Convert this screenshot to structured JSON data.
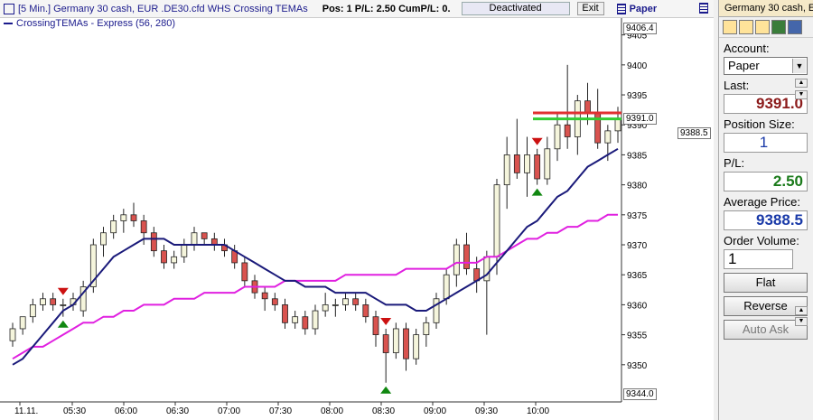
{
  "topbar": {
    "title": "[5 Min.] Germany 30 cash, EUR  .DE30.cfd WHS Crossing TEMAs",
    "stats": "Pos: 1  P/L: 2.50  CumP/L: 0.",
    "status_button": "Deactivated",
    "exit_button": "Exit",
    "account_label": "Paper"
  },
  "legend": {
    "text": "CrossingTEMAs - Express  (56, 280)"
  },
  "price_tags": {
    "top": "9406.4",
    "current": "9391.0",
    "average": "9388.5",
    "bottom": "9344.0"
  },
  "colors": {
    "fast_tema": "#1a1a7a",
    "slow_tema": "#e020e0",
    "candle_up": "#f5f5dc",
    "candle_down": "#d9534f",
    "stop_line": "#e03030",
    "target_line": "#33cc33"
  },
  "chart_data": {
    "type": "candlestick",
    "ylim": [
      9345,
      9406
    ],
    "yticks": [
      9350,
      9355,
      9360,
      9365,
      9370,
      9375,
      9380,
      9385,
      9390,
      9395,
      9400,
      9405
    ],
    "xticks": [
      "11.11.",
      "05:30",
      "06:00",
      "06:30",
      "07:00",
      "07:30",
      "08:00",
      "08:30",
      "09:00",
      "09:30",
      "10:00"
    ],
    "candles": [
      [
        9354,
        9357,
        9353,
        9356
      ],
      [
        9356,
        9358,
        9355,
        9358
      ],
      [
        9358,
        9361,
        9357,
        9360
      ],
      [
        9360,
        9362,
        9359,
        9361
      ],
      [
        9361,
        9362,
        9359,
        9360
      ],
      [
        9360,
        9361,
        9358,
        9360
      ],
      [
        9360,
        9362,
        9359,
        9361
      ],
      [
        9359,
        9364,
        9358,
        9363
      ],
      [
        9363,
        9371,
        9362,
        9370
      ],
      [
        9370,
        9373,
        9368,
        9372
      ],
      [
        9372,
        9375,
        9371,
        9374
      ],
      [
        9374,
        9376,
        9372,
        9375
      ],
      [
        9375,
        9377,
        9373,
        9374
      ],
      [
        9374,
        9375,
        9370,
        9372
      ],
      [
        9372,
        9373,
        9368,
        9369
      ],
      [
        9369,
        9370,
        9366,
        9367
      ],
      [
        9367,
        9369,
        9366,
        9368
      ],
      [
        9368,
        9371,
        9367,
        9370
      ],
      [
        9370,
        9373,
        9369,
        9372
      ],
      [
        9372,
        9372,
        9370,
        9371
      ],
      [
        9371,
        9372,
        9369,
        9370
      ],
      [
        9370,
        9371,
        9368,
        9369
      ],
      [
        9369,
        9370,
        9366,
        9367
      ],
      [
        9367,
        9368,
        9363,
        9364
      ],
      [
        9364,
        9365,
        9361,
        9362
      ],
      [
        9362,
        9363,
        9359,
        9361
      ],
      [
        9361,
        9362,
        9359,
        9360
      ],
      [
        9360,
        9361,
        9356,
        9357
      ],
      [
        9357,
        9359,
        9356,
        9358
      ],
      [
        9358,
        9359,
        9355,
        9356
      ],
      [
        9356,
        9360,
        9355,
        9359
      ],
      [
        9359,
        9362,
        9358,
        9360
      ],
      [
        9360,
        9361,
        9358,
        9360
      ],
      [
        9360,
        9362,
        9359,
        9361
      ],
      [
        9361,
        9362,
        9359,
        9360
      ],
      [
        9360,
        9361,
        9357,
        9358
      ],
      [
        9358,
        9359,
        9353,
        9355
      ],
      [
        9355,
        9356,
        9347,
        9352
      ],
      [
        9352,
        9357,
        9351,
        9356
      ],
      [
        9356,
        9357,
        9349,
        9351
      ],
      [
        9351,
        9356,
        9350,
        9355
      ],
      [
        9355,
        9358,
        9353,
        9357
      ],
      [
        9357,
        9362,
        9356,
        9361
      ],
      [
        9361,
        9366,
        9360,
        9365
      ],
      [
        9365,
        9371,
        9363,
        9370
      ],
      [
        9370,
        9372,
        9365,
        9366
      ],
      [
        9366,
        9368,
        9362,
        9364
      ],
      [
        9364,
        9369,
        9355,
        9368
      ],
      [
        9368,
        9381,
        9365,
        9380
      ],
      [
        9380,
        9388,
        9376,
        9385
      ],
      [
        9385,
        9391,
        9381,
        9382
      ],
      [
        9382,
        9388,
        9378,
        9385
      ],
      [
        9385,
        9386,
        9380,
        9381
      ],
      [
        9381,
        9388,
        9380,
        9386
      ],
      [
        9386,
        9392,
        9384,
        9390
      ],
      [
        9390,
        9400,
        9386,
        9388
      ],
      [
        9388,
        9395,
        9385,
        9394
      ],
      [
        9394,
        9397,
        9390,
        9392
      ],
      [
        9392,
        9396,
        9386,
        9387
      ],
      [
        9387,
        9390,
        9384,
        9389
      ],
      [
        9389,
        9393,
        9387,
        9391
      ]
    ],
    "fast_tema": [
      9350,
      9351,
      9353,
      9355,
      9357,
      9359,
      9360,
      9362,
      9364,
      9366,
      9368,
      9369,
      9370,
      9371,
      9371,
      9371,
      9370,
      9370,
      9370,
      9370,
      9370,
      9370,
      9369,
      9368,
      9367,
      9366,
      9365,
      9364,
      9364,
      9363,
      9363,
      9363,
      9362,
      9362,
      9362,
      9362,
      9361,
      9360,
      9360,
      9360,
      9359,
      9359,
      9360,
      9361,
      9362,
      9363,
      9364,
      9365,
      9367,
      9369,
      9371,
      9373,
      9374,
      9376,
      9378,
      9379,
      9381,
      9383,
      9384,
      9385,
      9386
    ],
    "slow_tema": [
      9351,
      9352,
      9353,
      9353,
      9354,
      9355,
      9356,
      9357,
      9357,
      9358,
      9358,
      9359,
      9359,
      9360,
      9360,
      9360,
      9361,
      9361,
      9361,
      9362,
      9362,
      9362,
      9362,
      9363,
      9363,
      9363,
      9363,
      9364,
      9364,
      9364,
      9364,
      9364,
      9364,
      9365,
      9365,
      9365,
      9365,
      9365,
      9365,
      9366,
      9366,
      9366,
      9366,
      9366,
      9367,
      9367,
      9367,
      9368,
      9368,
      9369,
      9370,
      9371,
      9371,
      9372,
      9372,
      9373,
      9373,
      9374,
      9374,
      9375,
      9375
    ],
    "signals": [
      {
        "index": 5,
        "type": "both"
      },
      {
        "index": 37,
        "type": "both"
      },
      {
        "index": 52,
        "type": "both"
      }
    ],
    "levels": {
      "stop": 9392,
      "target": 9391
    }
  },
  "panel": {
    "title": "Germany 30 cash, E",
    "account_label": "Account:",
    "account_value": "Paper",
    "last_label": "Last:",
    "last_value": "9391.0",
    "position_label": "Position Size:",
    "position_value": "1",
    "pl_label": "P/L:",
    "pl_value": "2.50",
    "avg_label": "Average Price:",
    "avg_value": "9388.5",
    "volume_label": "Order Volume:",
    "volume_value": "1",
    "flat_button": "Flat",
    "reverse_button": "Reverse",
    "auto_ask_button": "Auto Ask"
  }
}
